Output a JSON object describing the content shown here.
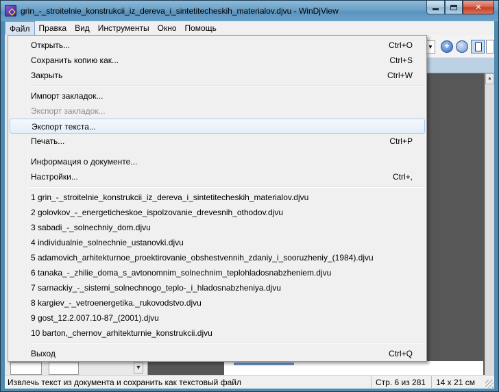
{
  "window": {
    "title": "grin_-_stroitelnie_konstrukcii_iz_dereva_i_sintetitecheskih_materialov.djvu - WinDjView"
  },
  "menubar": {
    "items": [
      "Файл",
      "Правка",
      "Вид",
      "Инструменты",
      "Окно",
      "Помощь"
    ]
  },
  "file_menu": {
    "open": {
      "label": "Открыть...",
      "shortcut": "Ctrl+O"
    },
    "save_copy": {
      "label": "Сохранить копию как...",
      "shortcut": "Ctrl+S"
    },
    "close": {
      "label": "Закрыть",
      "shortcut": "Ctrl+W"
    },
    "import_bookmarks": {
      "label": "Импорт закладок..."
    },
    "export_bookmarks": {
      "label": "Экспорт закладок..."
    },
    "export_text": {
      "label": "Экспорт текста..."
    },
    "print": {
      "label": "Печать...",
      "shortcut": "Ctrl+P"
    },
    "doc_info": {
      "label": "Информация о документе..."
    },
    "settings": {
      "label": "Настройки...",
      "shortcut": "Ctrl+,"
    },
    "recent": [
      "1 grin_-_stroitelnie_konstrukcii_iz_dereva_i_sintetitecheskih_materialov.djvu",
      "2 golovkov_-_energeticheskoe_ispolzovanie_drevesnih_othodov.djvu",
      "3 sabadi_-_solnechniy_dom.djvu",
      "4 individualnie_solnechnie_ustanovki.djvu",
      "5 adamovich_arhitekturnoe_proektirovanie_obshestvennih_zdaniy_i_sooruzheniy_(1984).djvu",
      "6 tanaka_-_zhilie_doma_s_avtonomnim_solnechnim_teplohladosnabzheniem.djvu",
      "7 sarnackiy_-_sistemi_solnechnogo_teplo-_i_hladosnabzheniya.djvu",
      "8 kargiev_-_vetroenergetika._rukovodstvo.djvu",
      "9 gost_12.2.007.10-87_(2001).djvu",
      "10 barton,_chernov_arhitekturnie_konstrukcii.djvu"
    ],
    "exit": {
      "label": "Выход",
      "shortcut": "Ctrl+Q"
    }
  },
  "toolbar": {
    "zoom_in_glyph": "+",
    "icons": [
      "dropdown-arrow-icon",
      "zoom-in-icon",
      "fit-page-icon",
      "single-page-icon"
    ]
  },
  "statusbar": {
    "hint": "Извлечь текст из документа и сохранить как текстовый файл",
    "page": "Стр. 6 из 281",
    "size": "14 x 21 см"
  },
  "colors": {
    "titlebar": "#6aa0c6",
    "menu_bg": "#f0f0f0",
    "hover_border": "#a8c7ea",
    "disabled_text": "#8d8d8d",
    "content_bg": "#575757"
  }
}
